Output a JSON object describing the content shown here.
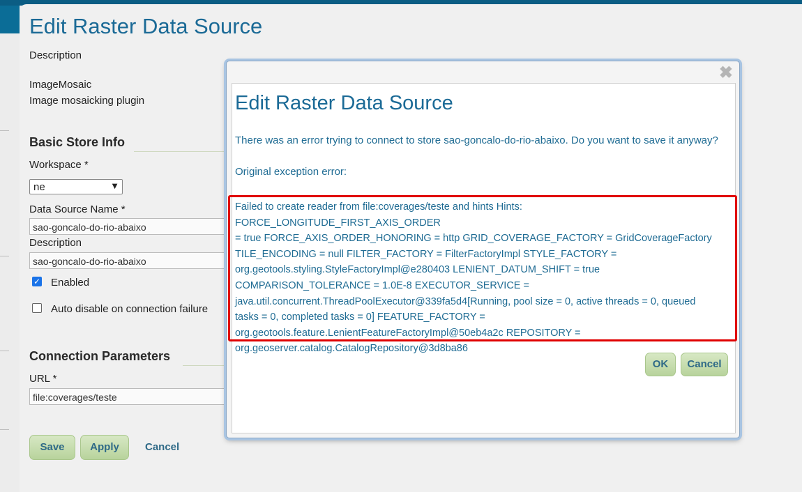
{
  "page": {
    "title": "Edit Raster Data Source",
    "description_label": "Description",
    "plugin_name": "ImageMosaic",
    "plugin_description": "Image mosaicking plugin"
  },
  "basic_store_info": {
    "heading": "Basic Store Info",
    "workspace_label": "Workspace *",
    "workspace_value": "ne",
    "data_source_name_label": "Data Source Name *",
    "data_source_name_value": "sao-goncalo-do-rio-abaixo",
    "description_label": "Description",
    "description_value": "sao-goncalo-do-rio-abaixo",
    "enabled_label": "Enabled",
    "enabled_checked": true,
    "auto_disable_label": "Auto disable on connection failure",
    "auto_disable_checked": false
  },
  "connection_parameters": {
    "heading": "Connection Parameters",
    "url_label": "URL *",
    "url_value": "file:coverages/teste"
  },
  "form_actions": {
    "save_label": "Save",
    "apply_label": "Apply",
    "cancel_label": "Cancel"
  },
  "dialog": {
    "close_glyph": "✖",
    "title": "Edit Raster Data Source",
    "message": "There was an error trying to connect to store sao-goncalo-do-rio-abaixo. Do you want to save it anyway?",
    "exception_label": "Original exception error:",
    "exception_lines": [
      "Failed to create reader from file:coverages/teste and hints Hints: FORCE_LONGITUDE_FIRST_AXIS_ORDER",
      "= true FORCE_AXIS_ORDER_HONORING = http GRID_COVERAGE_FACTORY = GridCoverageFactory",
      "TILE_ENCODING = null FILTER_FACTORY = FilterFactoryImpl STYLE_FACTORY =",
      "org.geotools.styling.StyleFactoryImpl@e280403 LENIENT_DATUM_SHIFT = true",
      "COMPARISON_TOLERANCE = 1.0E-8 EXECUTOR_SERVICE =",
      "java.util.concurrent.ThreadPoolExecutor@339fa5d4[Running, pool size = 0, active threads = 0, queued",
      "tasks = 0, completed tasks = 0] FEATURE_FACTORY =",
      "org.geotools.feature.LenientFeatureFactoryImpl@50eb4a2c REPOSITORY =",
      "org.geoserver.catalog.CatalogRepository@3d8ba86"
    ],
    "ok_label": "OK",
    "cancel_label": "Cancel"
  },
  "colors": {
    "title": "#1b6a96",
    "dialog_text": "#1e6b93",
    "highlight_border": "#e00000",
    "button_green": "#c8dfb0"
  }
}
